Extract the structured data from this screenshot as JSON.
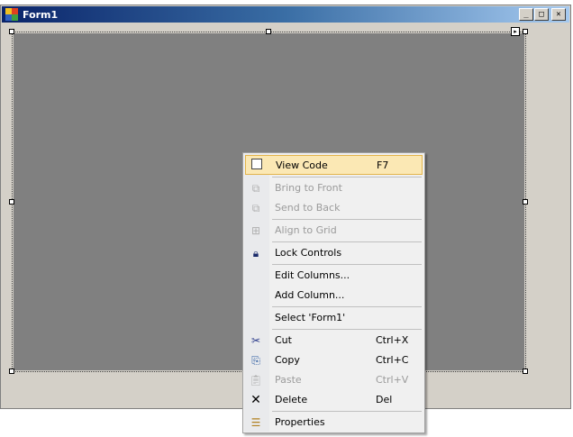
{
  "window": {
    "title": "Form1",
    "minimize_glyph": "_",
    "maximize_glyph": "□",
    "close_glyph": "✕"
  },
  "smart_tag": {
    "glyph": "▸"
  },
  "context_menu": {
    "items": [
      {
        "label": "View Code",
        "shortcut": "F7",
        "icon": "view-code-icon",
        "enabled": true,
        "highlighted": true
      },
      {
        "label": "Bring to Front",
        "shortcut": "",
        "icon": "bring-to-front-icon",
        "enabled": false
      },
      {
        "label": "Send to Back",
        "shortcut": "",
        "icon": "send-to-back-icon",
        "enabled": false
      },
      {
        "label": "Align to Grid",
        "shortcut": "",
        "icon": "align-to-grid-icon",
        "enabled": false
      },
      {
        "label": "Lock Controls",
        "shortcut": "",
        "icon": "lock-icon",
        "enabled": true
      },
      {
        "label": "Edit Columns...",
        "shortcut": "",
        "icon": "",
        "enabled": true
      },
      {
        "label": "Add Column...",
        "shortcut": "",
        "icon": "",
        "enabled": true
      },
      {
        "label": "Select 'Form1'",
        "shortcut": "",
        "icon": "",
        "enabled": true
      },
      {
        "label": "Cut",
        "shortcut": "Ctrl+X",
        "icon": "cut-icon",
        "enabled": true
      },
      {
        "label": "Copy",
        "shortcut": "Ctrl+C",
        "icon": "copy-icon",
        "enabled": true
      },
      {
        "label": "Paste",
        "shortcut": "Ctrl+V",
        "icon": "paste-icon",
        "enabled": false
      },
      {
        "label": "Delete",
        "shortcut": "Del",
        "icon": "delete-icon",
        "enabled": true
      },
      {
        "label": "Properties",
        "shortcut": "",
        "icon": "properties-icon",
        "enabled": true
      }
    ]
  }
}
